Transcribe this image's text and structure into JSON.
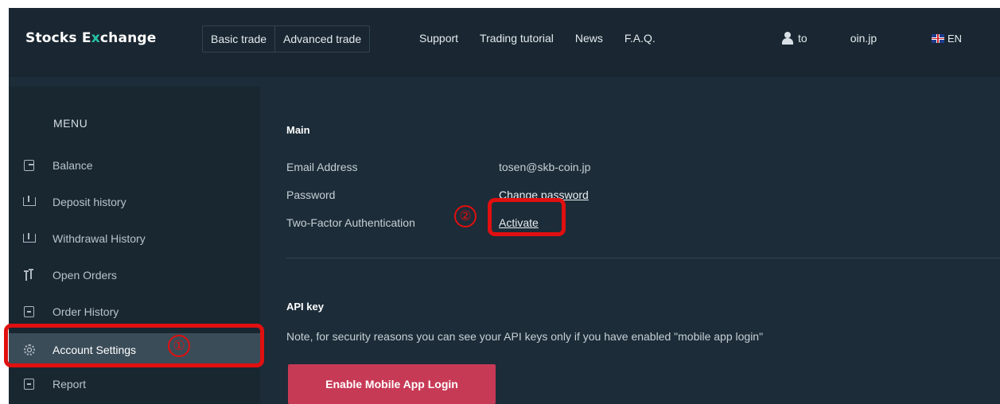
{
  "header": {
    "logo_prefix": "Stocks E",
    "logo_x": "x",
    "logo_suffix": "change",
    "trade_tabs": [
      "Basic trade",
      "Advanced trade"
    ],
    "nav": [
      "Support",
      "Trading tutorial",
      "News",
      "F.A.Q."
    ],
    "user_prefix": "to",
    "user_suffix": "oin.jp",
    "language": "EN"
  },
  "sidebar": {
    "title": "MENU",
    "items": [
      {
        "label": "Balance",
        "icon": "wallet-icon"
      },
      {
        "label": "Deposit history",
        "icon": "deposit-tray-icon"
      },
      {
        "label": "Withdrawal History",
        "icon": "withdrawal-tray-icon"
      },
      {
        "label": "Open Orders",
        "icon": "orders-arrows-icon"
      },
      {
        "label": "Order History",
        "icon": "order-history-icon"
      },
      {
        "label": "Account Settings",
        "icon": "gear-icon",
        "active": true
      },
      {
        "label": "Report",
        "icon": "report-icon"
      }
    ]
  },
  "main": {
    "main_title": "Main",
    "rows": [
      {
        "label": "Email Address",
        "value": "tosen@skb-coin.jp"
      },
      {
        "label": "Password",
        "value": "Change password"
      },
      {
        "label": "Two-Factor Authentication",
        "value": "Activate"
      }
    ],
    "api_title": "API key",
    "api_note": "Note, for security reasons you can see your API keys only if you have enabled \"mobile app login\"",
    "enable_button": "Enable Mobile App Login"
  },
  "annotations": {
    "marker_1": "①",
    "marker_2": "②",
    "color": "#e01010"
  },
  "colors": {
    "accent_x": "#27c3a5",
    "button": "#c73a56",
    "background": "#1c2c38"
  }
}
